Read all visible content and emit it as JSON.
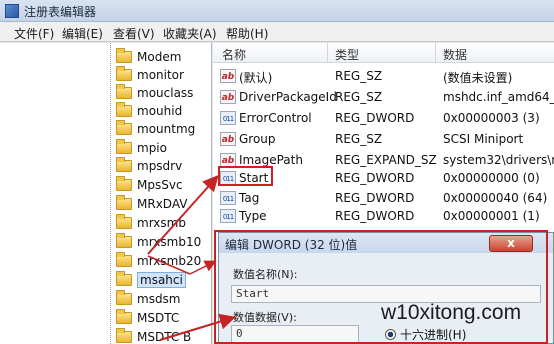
{
  "window": {
    "title": "注册表编辑器"
  },
  "menu": [
    "文件(F)",
    "编辑(E)",
    "查看(V)",
    "收藏夹(A)",
    "帮助(H)"
  ],
  "tree": [
    {
      "label": "Modem"
    },
    {
      "label": "monitor"
    },
    {
      "label": "mouclass"
    },
    {
      "label": "mouhid"
    },
    {
      "label": "mountmg"
    },
    {
      "label": "mpio"
    },
    {
      "label": "mpsdrv"
    },
    {
      "label": "MpsSvc"
    },
    {
      "label": "MRxDAV"
    },
    {
      "label": "mrxsmb"
    },
    {
      "label": "mrxsmb10"
    },
    {
      "label": "mrxsmb20"
    },
    {
      "label": "msahci",
      "selected": true
    },
    {
      "label": "msdsm"
    },
    {
      "label": "MSDTC"
    },
    {
      "label": "MSDTC B"
    }
  ],
  "columns": {
    "name": "名称",
    "type": "类型",
    "data": "数据"
  },
  "values": [
    {
      "icon": "ab",
      "name": "(默认)",
      "type": "REG_SZ",
      "data": "(数值未设置)"
    },
    {
      "icon": "ab",
      "name": "DriverPackageId",
      "type": "REG_SZ",
      "data": "mshdc.inf_amd64_n"
    },
    {
      "icon": "bin",
      "name": "ErrorControl",
      "type": "REG_DWORD",
      "data": "0x00000003 (3)"
    },
    {
      "icon": "ab",
      "name": "Group",
      "type": "REG_SZ",
      "data": "SCSI Miniport"
    },
    {
      "icon": "ab",
      "name": "ImagePath",
      "type": "REG_EXPAND_SZ",
      "data": "system32\\drivers\\m"
    },
    {
      "icon": "bin",
      "name": "Start",
      "type": "REG_DWORD",
      "data": "0x00000000 (0)"
    },
    {
      "icon": "bin",
      "name": "Tag",
      "type": "REG_DWORD",
      "data": "0x00000040 (64)"
    },
    {
      "icon": "bin",
      "name": "Type",
      "type": "REG_DWORD",
      "data": "0x00000001 (1)"
    }
  ],
  "dialog": {
    "title": "编辑 DWORD (32 位)值",
    "close": "x",
    "value_name_label": "数值名称(N):",
    "value_name": "Start",
    "value_data_label": "数值数据(V):",
    "value_data": "0",
    "base_hex": "十六进制(H)"
  },
  "watermark": "w10xitong.com",
  "colors": {
    "highlight": "#d02020",
    "selection": "#cfe3fb"
  }
}
